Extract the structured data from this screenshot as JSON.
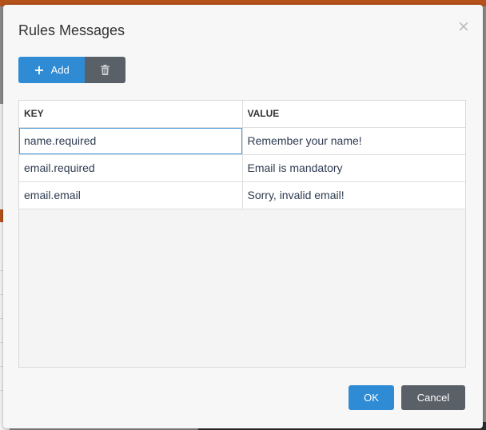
{
  "dialog": {
    "title": "Rules Messages",
    "close_glyph": "×"
  },
  "toolbar": {
    "add_label": "Add",
    "add_icon": "plus-icon",
    "delete_icon": "trash-icon"
  },
  "table": {
    "columns": [
      "KEY",
      "VALUE"
    ],
    "rows": [
      {
        "key": "name.required",
        "value": "Remember your name!"
      },
      {
        "key": "email.required",
        "value": "Email is mandatory"
      },
      {
        "key": "email.email",
        "value": "Sorry, invalid email!"
      }
    ]
  },
  "footer": {
    "ok_label": "OK",
    "cancel_label": "Cancel"
  },
  "colors": {
    "primary": "#2e8bd4",
    "secondary": "#5a6068",
    "accent_bar": "#b5521b"
  }
}
